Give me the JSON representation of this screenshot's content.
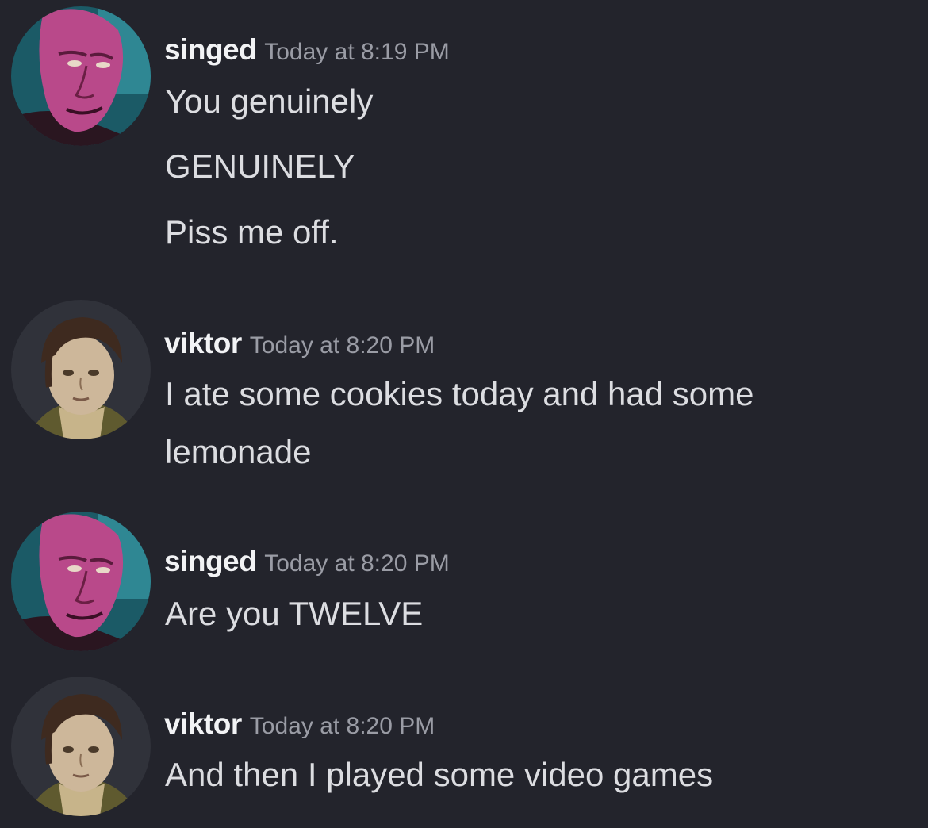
{
  "colors": {
    "background": "#23242c",
    "username": "#f2f3f5",
    "timestamp": "#9a9ca5",
    "message_text": "#dcdde1"
  },
  "messages": [
    {
      "author": "singed",
      "avatar_icon": "singed-avatar-icon",
      "timestamp": "Today at 8:19 PM",
      "lines": [
        "You genuinely",
        "GENUINELY",
        "Piss me off."
      ]
    },
    {
      "author": "viktor",
      "avatar_icon": "viktor-avatar-icon",
      "timestamp": "Today at 8:20 PM",
      "lines": [
        "I ate some cookies today and had some",
        "lemonade"
      ]
    },
    {
      "author": "singed",
      "avatar_icon": "singed-avatar-icon",
      "timestamp": "Today at 8:20 PM",
      "lines": [
        "Are you TWELVE"
      ]
    },
    {
      "author": "viktor",
      "avatar_icon": "viktor-avatar-icon",
      "timestamp": "Today at 8:20 PM",
      "lines": [
        "And then I played some video games"
      ]
    }
  ]
}
